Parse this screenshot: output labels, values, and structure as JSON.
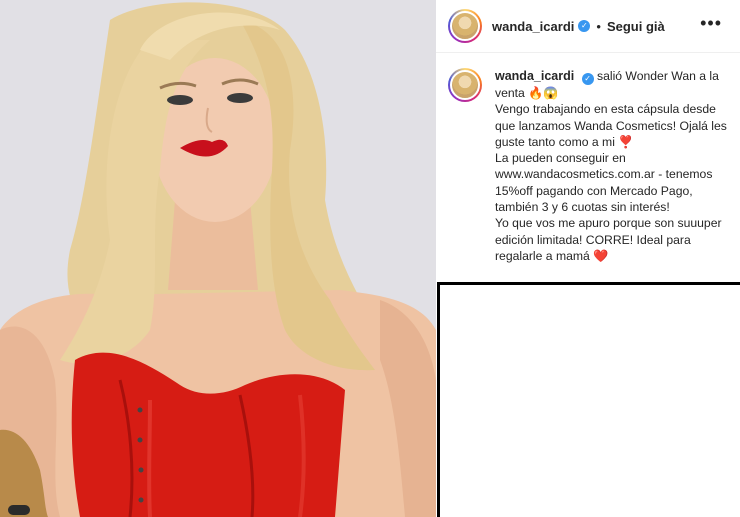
{
  "post": {
    "username": "wanda_icardi",
    "follow_label": "Segui già",
    "separator": "•",
    "more_icon": "more-horizontal-icon",
    "verified_icon": "verified-badge-icon"
  },
  "caption": {
    "username": "wanda_icardi",
    "lines": [
      "salió Wonder Wan a la venta 🔥😱",
      "Vengo trabajando en esta cápsula desde que lanzamos Wanda Cosmetics! Ojalá les guste tanto como a mi ❣️",
      "La pueden conseguir en www.wandacosmetics.com.ar - tenemos 15%off pagando con Mercado Pago, también 3 y 6 cuotas sin interés!",
      "Yo que vos me apuro porque son suuuper edición limitada! CORRE! Ideal para regalarle a mamá ❤️"
    ]
  },
  "colors": {
    "verified": "#3897f0",
    "dress": "#d61c14",
    "lips": "#c8101c"
  }
}
